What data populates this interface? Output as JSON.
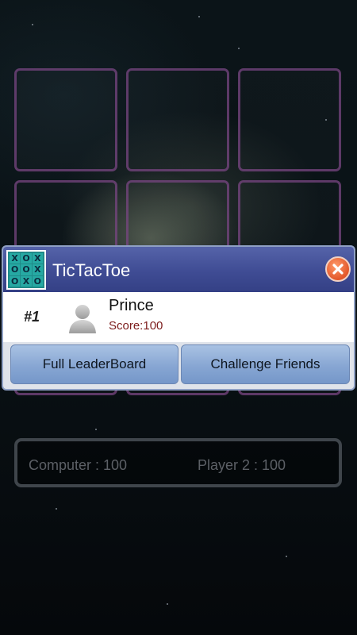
{
  "popup": {
    "title": "TicTacToe",
    "logo_cells": [
      "X",
      "O",
      "X",
      "O",
      "O",
      "X",
      "O",
      "X",
      "O"
    ],
    "close_icon": "close-icon",
    "leader": {
      "rank": "#1",
      "avatar_icon": "user-silhouette-icon",
      "name": "Prince",
      "score": "Score:100"
    },
    "buttons": {
      "full_leaderboard": "Full LeaderBoard",
      "challenge_friends": "Challenge Friends"
    }
  },
  "scoreboard": {
    "computer": "Computer : 100",
    "player2": "Player 2 : 100"
  },
  "colors": {
    "header": "#3f4c94",
    "cell_border": "#784682",
    "button": "#87a6d3",
    "close": "#e2572a"
  }
}
